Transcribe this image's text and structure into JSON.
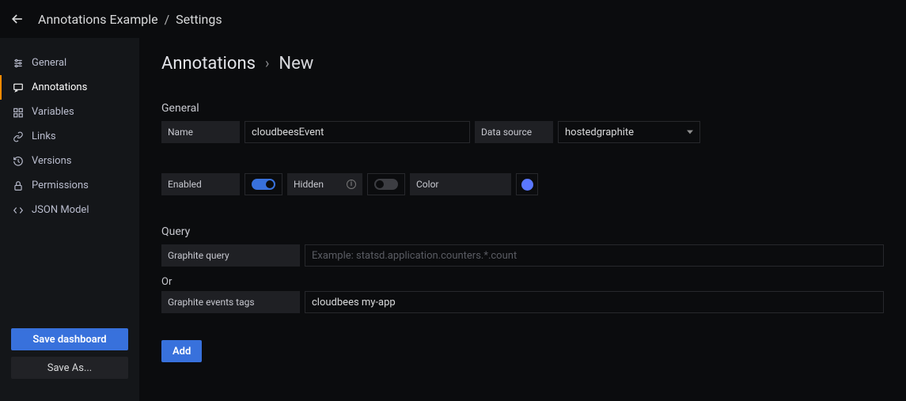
{
  "topbar": {
    "crumb_a": "Annotations Example",
    "crumb_sep": "/",
    "crumb_b": "Settings"
  },
  "sidebar": {
    "items": [
      {
        "label": "General"
      },
      {
        "label": "Annotations"
      },
      {
        "label": "Variables"
      },
      {
        "label": "Links"
      },
      {
        "label": "Versions"
      },
      {
        "label": "Permissions"
      },
      {
        "label": "JSON Model"
      }
    ],
    "save_label": "Save dashboard",
    "saveas_label": "Save As..."
  },
  "crumb": {
    "a": "Annotations",
    "b": "New"
  },
  "sections": {
    "general_title": "General",
    "query_title": "Query"
  },
  "form": {
    "name_label": "Name",
    "name_value": "cloudbeesEvent",
    "datasource_label": "Data source",
    "datasource_value": "hostedgraphite",
    "enabled_label": "Enabled",
    "enabled": true,
    "hidden_label": "Hidden",
    "hidden": false,
    "color_label": "Color",
    "color_value": "#5a77ff"
  },
  "query": {
    "graphite_query_label": "Graphite query",
    "graphite_query_value": "",
    "graphite_query_placeholder": "Example: statsd.application.counters.*.count",
    "or_label": "Or",
    "tags_label": "Graphite events tags",
    "tags_value": "cloudbees my-app"
  },
  "add_label": "Add"
}
